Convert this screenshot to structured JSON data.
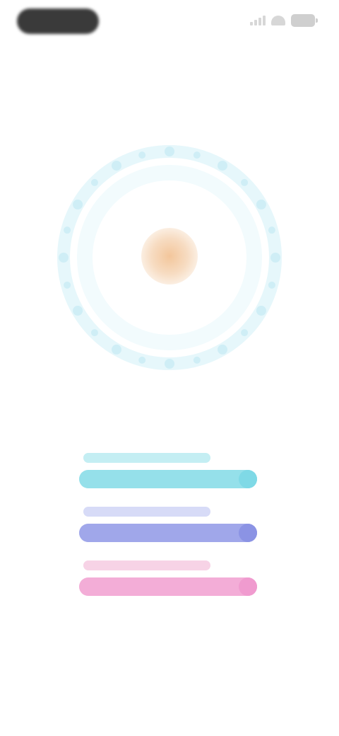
{
  "status_bar": {
    "icons": [
      "signal-icon",
      "wifi-icon",
      "battery-icon"
    ]
  },
  "breath_ring": {
    "dot_count": 24,
    "dot_color": "#cfeef6",
    "ring_color": "#e6f7fb",
    "center_color": "#f3c69b"
  },
  "bars": [
    {
      "name": "cyan",
      "color": "#7fd9e6",
      "track_color": "#d6f3f7",
      "label_color": "#c4eef3",
      "fill": 1.0
    },
    {
      "name": "indigo",
      "color": "#8b93e4",
      "track_color": "#dfe2f9",
      "label_color": "#d7dbf7",
      "fill": 1.0
    },
    {
      "name": "pink",
      "color": "#f09bcf",
      "track_color": "#fbe1ef",
      "label_color": "#f7d3e6",
      "fill": 1.0
    }
  ]
}
